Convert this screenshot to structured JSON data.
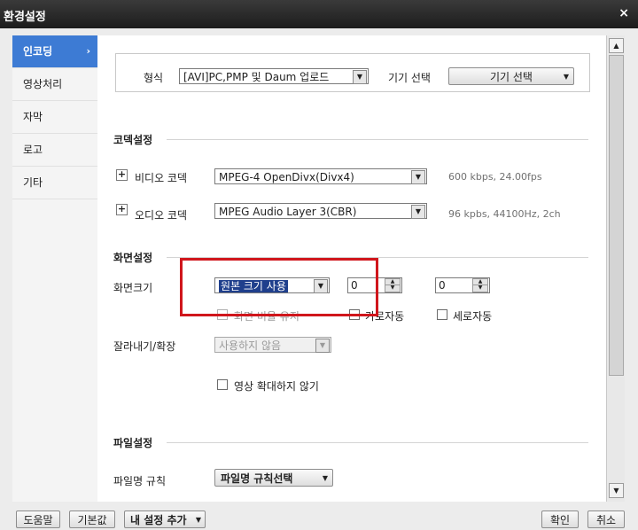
{
  "window": {
    "title": "환경설정",
    "close_glyph": "×"
  },
  "sidebar": {
    "items": [
      {
        "label": "인코딩",
        "active": true
      },
      {
        "label": "영상처리"
      },
      {
        "label": "자막"
      },
      {
        "label": "로고"
      },
      {
        "label": "기타"
      }
    ]
  },
  "format": {
    "label": "형식",
    "value": "[AVI]PC,PMP 및 Daum 업로드",
    "device_label": "기기 선택",
    "device_button": "기기 선택"
  },
  "codec": {
    "title": "코덱설정",
    "video": {
      "label": "비디오 코덱",
      "value": "MPEG-4 OpenDivx(Divx4)",
      "info": "600 kbps, 24.00fps"
    },
    "audio": {
      "label": "오디오 코덱",
      "value": "MPEG Audio Layer 3(CBR)",
      "info": "96 kpbs, 44100Hz, 2ch"
    }
  },
  "screen": {
    "title": "화면설정",
    "size_label": "화면크기",
    "size_value": "원본 크기 사용",
    "width_value": "0",
    "height_value": "0",
    "keep_ratio": "화면 비율 유지",
    "auto_width": "가로자동",
    "auto_height": "세로자동",
    "crop_label": "잘라내기/확장",
    "crop_value": "사용하지 않음",
    "no_enlarge": "영상 확대하지 않기"
  },
  "file": {
    "title": "파일설정",
    "rule_label": "파일명 규칙",
    "rule_button": "파일명 규칙선택"
  },
  "footer": {
    "help": "도움말",
    "default": "기본값",
    "my_settings": "내 설정 추가",
    "ok": "확인",
    "cancel": "취소"
  },
  "colors": {
    "accent": "#3d7bd4",
    "highlight": "#d0161c",
    "selection": "#1f3f8c"
  }
}
